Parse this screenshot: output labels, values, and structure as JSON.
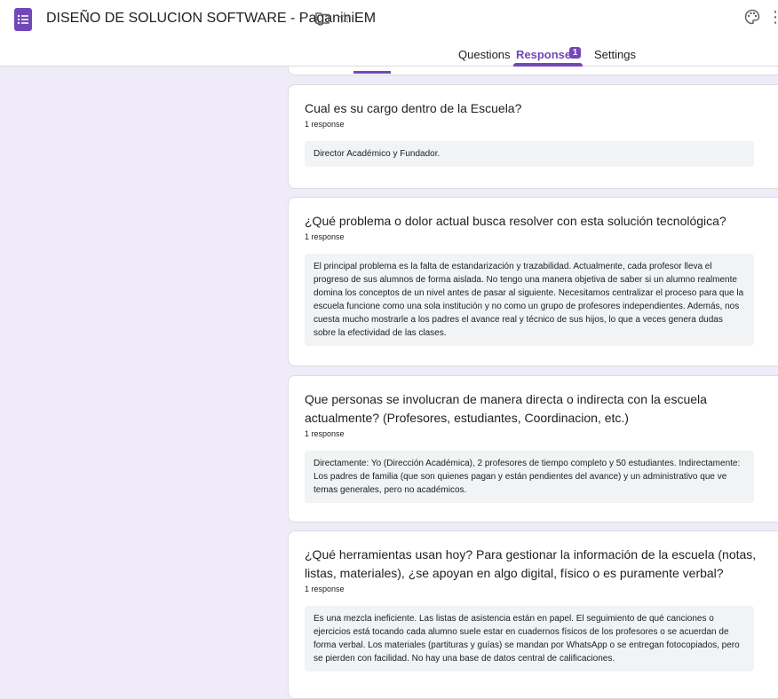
{
  "header": {
    "doc_title": "DISEÑO DE SOLUCION SOFTWARE - PaganiniEM",
    "icons": [
      "forms-app-icon",
      "folder-icon",
      "star-icon",
      "palette-icon",
      "more-icon"
    ]
  },
  "tabs": {
    "questions": "Questions",
    "responses": "Responses",
    "responses_badge": "1",
    "settings": "Settings",
    "active": "responses"
  },
  "colors": {
    "accent": "#7248b9",
    "background": "#f0ebf8"
  },
  "questions": [
    {
      "title": "Cual es su cargo dentro de la Escuela?",
      "count": "1 response",
      "answer": "Director Académico y Fundador."
    },
    {
      "title": "¿Qué problema o dolor actual busca resolver con esta solución tecnológica?",
      "count": "1 response",
      "answer": "El principal problema es la falta de estandarización y trazabilidad. Actualmente, cada profesor lleva el progreso de sus alumnos de forma aislada. No tengo una manera objetiva de saber si un alumno realmente domina los conceptos de un nivel antes de pasar al siguiente. Necesitamos centralizar el proceso para que la escuela funcione como una sola institución y no como un grupo de profesores independientes. Además, nos cuesta mucho mostrarle a los padres el avance real y técnico de sus hijos, lo que a veces genera dudas sobre la efectividad de las clases."
    },
    {
      "title": "Que personas se involucran de manera directa o indirecta con la escuela actualmente? (Profesores, estudiantes, Coordinacion, etc.)",
      "count": "1 response",
      "answer": "Directamente: Yo (Dirección Académica), 2 profesores de tiempo completo y 50 estudiantes. Indirectamente: Los padres de familia (que son quienes pagan y están pendientes del avance) y un administrativo que ve temas generales, pero no académicos."
    },
    {
      "title": "¿Qué herramientas usan hoy? Para gestionar la información de la escuela (notas, listas, materiales), ¿se apoyan en algo digital, físico o es puramente verbal?",
      "count": "1 response",
      "answer": "Es una mezcla ineficiente. Las listas de asistencia están en papel. El seguimiento de qué canciones o ejercicios está tocando cada alumno suele estar en cuadernos físicos de los profesores o se acuerdan de forma verbal. Los materiales (partituras y guías) se mandan por WhatsApp o se entregan fotocopiados, pero se pierden con facilidad. No hay una base de datos central de calificaciones."
    }
  ]
}
